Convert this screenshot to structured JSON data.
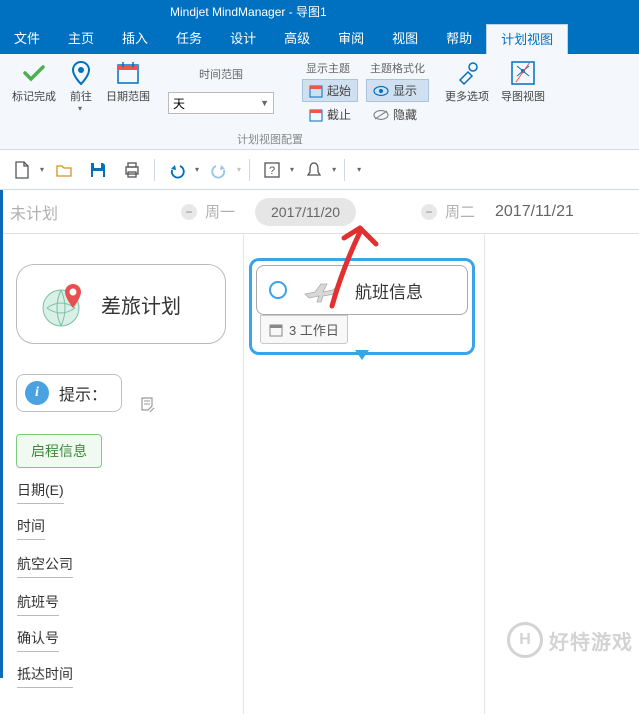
{
  "titlebar": "Mindjet MindManager - 导图1",
  "menu": {
    "items": [
      "文件",
      "主页",
      "插入",
      "任务",
      "设计",
      "高级",
      "审阅",
      "视图",
      "帮助",
      "计划视图"
    ],
    "active_index": 9
  },
  "ribbon": {
    "mark_done": "标记完成",
    "goto": "前往",
    "date_range": "日期范围",
    "time_range": "时间范围",
    "day_dropdown": "天",
    "show_topic": "显示主题",
    "start": "起始",
    "end": "截止",
    "topic_format": "主题格式化",
    "show": "显示",
    "hide": "隐藏",
    "more_options": "更多选项",
    "mindmap_view": "导图视图",
    "group_label": "计划视图配置"
  },
  "timeline": {
    "unplanned": "未计划",
    "monday": "周一",
    "date1": "2017/11/20",
    "tuesday": "周二",
    "date2": "2017/11/21"
  },
  "topics": {
    "travel_plan": "差旅计划",
    "flight_info": "航班信息",
    "work_days": "3 工作日",
    "tip": "提示：",
    "launch_info": "启程信息"
  },
  "fields": [
    "日期(E)",
    "时间",
    "航空公司",
    "航班号",
    "确认号",
    "抵达时间"
  ],
  "watermark": "好特游戏"
}
